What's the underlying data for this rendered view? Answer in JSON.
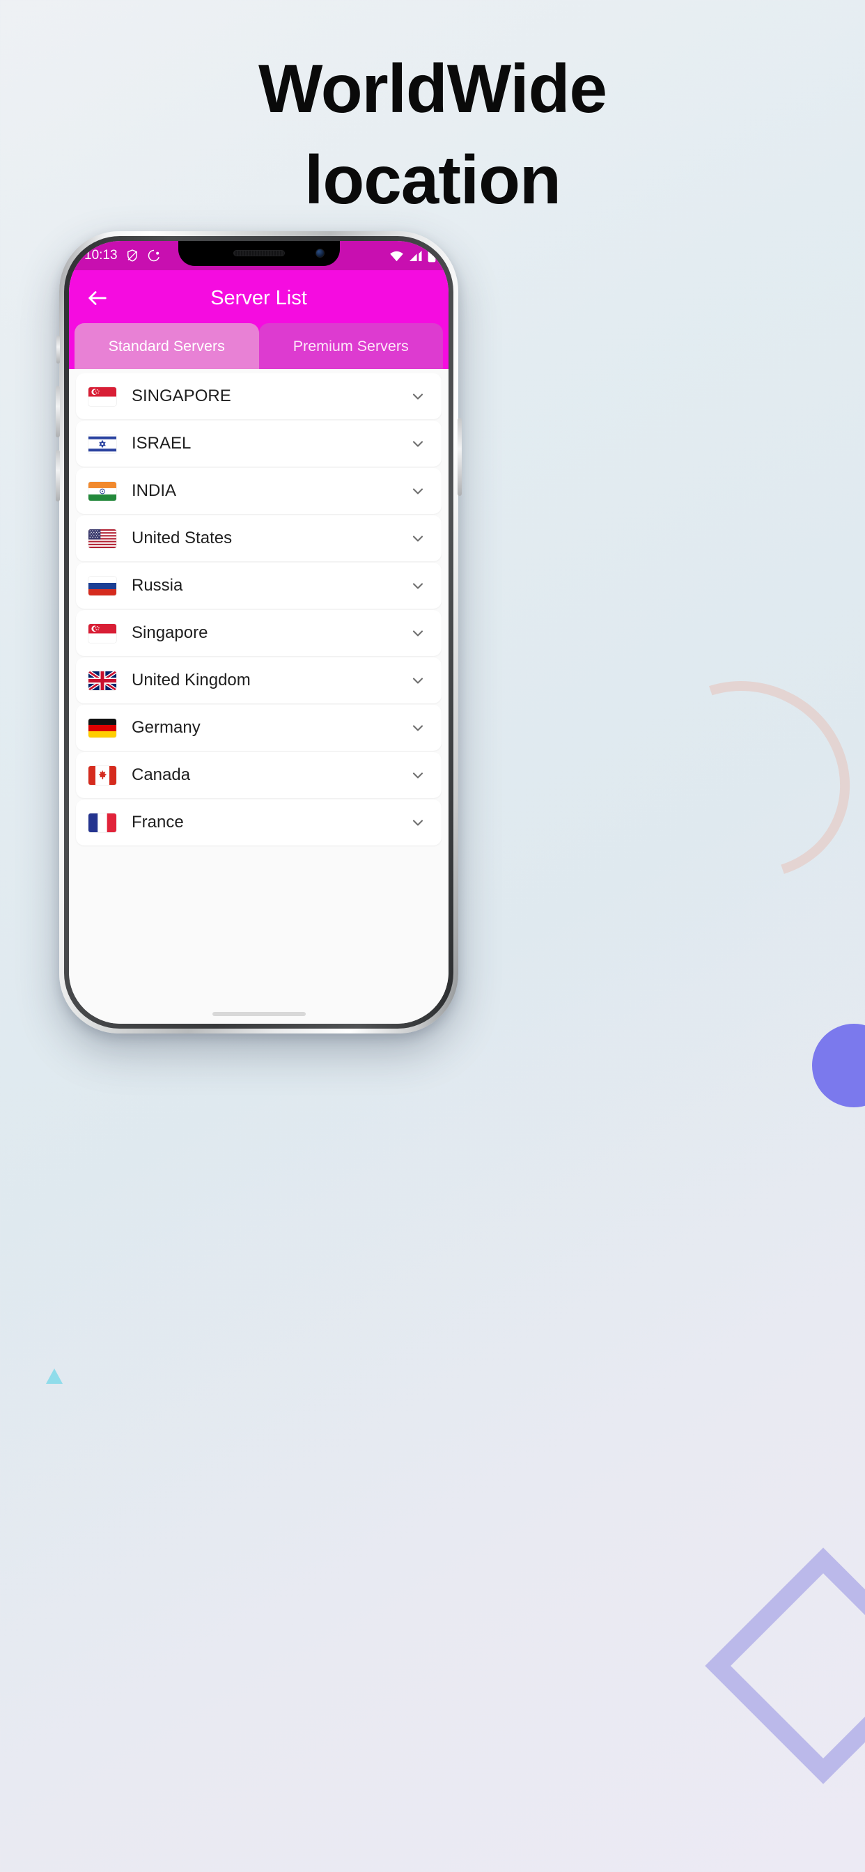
{
  "headline": "WorldWide\nlocation",
  "headline_line1": "WorldWide",
  "headline_line2": "location",
  "statusbar": {
    "time": "10:13",
    "icons": [
      "shield-icon",
      "vpn-key-icon",
      "wifi-icon",
      "cellular-signal-icon",
      "battery-icon"
    ]
  },
  "appbar": {
    "title": "Server List",
    "back_icon": "back-arrow-icon"
  },
  "tabs": [
    {
      "label": "Standard Servers",
      "active": true
    },
    {
      "label": "Premium Servers",
      "active": false
    }
  ],
  "colors": {
    "brand_magenta": "#f50ce0",
    "statusbar_magenta": "#c80fb0",
    "tab_active": "#e881d5",
    "tab_inactive": "#dd3bd0",
    "chevron_gray": "#6e6e6e",
    "page_bg": "#e7edf1",
    "deco_purple": "#7b79ed",
    "deco_diamond": "#b3b0e8",
    "deco_cyan": "#8fdcea"
  },
  "servers": [
    {
      "name": "SINGAPORE",
      "flag": "singapore-flag-icon",
      "chevron": "chevron-down-icon"
    },
    {
      "name": "ISRAEL",
      "flag": "israel-flag-icon",
      "chevron": "chevron-down-icon"
    },
    {
      "name": "INDIA",
      "flag": "india-flag-icon",
      "chevron": "chevron-down-icon"
    },
    {
      "name": "United States",
      "flag": "united-states-flag-icon",
      "chevron": "chevron-down-icon"
    },
    {
      "name": "Russia",
      "flag": "russia-flag-icon",
      "chevron": "chevron-down-icon"
    },
    {
      "name": "Singapore",
      "flag": "singapore-flag-icon",
      "chevron": "chevron-down-icon"
    },
    {
      "name": "United Kingdom",
      "flag": "united-kingdom-flag-icon",
      "chevron": "chevron-down-icon"
    },
    {
      "name": "Germany",
      "flag": "germany-flag-icon",
      "chevron": "chevron-down-icon"
    },
    {
      "name": "Canada",
      "flag": "canada-flag-icon",
      "chevron": "chevron-down-icon"
    },
    {
      "name": "France",
      "flag": "france-flag-icon",
      "chevron": "chevron-down-icon"
    }
  ]
}
